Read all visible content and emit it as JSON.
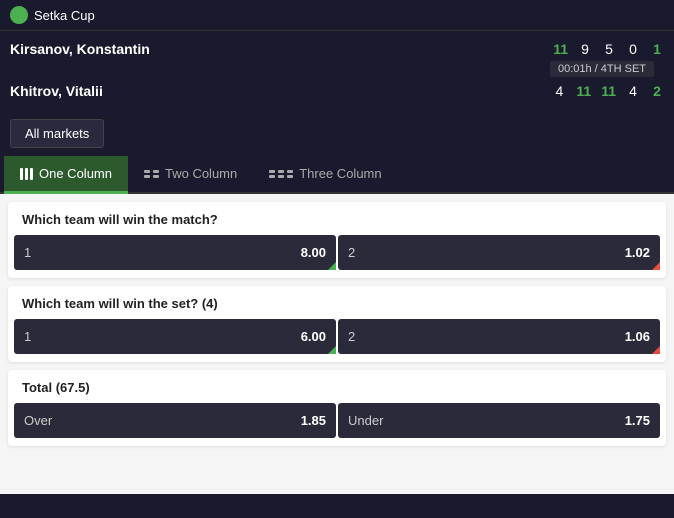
{
  "header": {
    "icon_color": "#4caf50",
    "title": "Setka Cup"
  },
  "match": {
    "player1": {
      "name": "Kirsanov, Konstantin",
      "scores": [
        "11",
        "9",
        "5",
        "0"
      ],
      "current_set_score": "1"
    },
    "player2": {
      "name": "Khitrov, Vitalii",
      "scores": [
        "4",
        "11",
        "11",
        "4"
      ],
      "current_set_score": "2"
    },
    "timer": "00:01h / 4TH SET"
  },
  "markets_button": {
    "label": "All markets"
  },
  "tabs": [
    {
      "id": "one-column",
      "label": "One Column",
      "icon": "one-col",
      "active": true
    },
    {
      "id": "two-column",
      "label": "Two Column",
      "icon": "two-col",
      "active": false
    },
    {
      "id": "three-column",
      "label": "Three Column",
      "icon": "three-col",
      "active": false
    }
  ],
  "markets": [
    {
      "id": "match-winner",
      "title": "Which team will win the match?",
      "odds": [
        {
          "label": "1",
          "value": "8.00",
          "indicator": "green"
        },
        {
          "label": "2",
          "value": "1.02",
          "indicator": "red"
        }
      ]
    },
    {
      "id": "set-winner",
      "title": "Which team will win the set? (4)",
      "odds": [
        {
          "label": "1",
          "value": "6.00",
          "indicator": "green"
        },
        {
          "label": "2",
          "value": "1.06",
          "indicator": "red"
        }
      ]
    },
    {
      "id": "total",
      "title": "Total (67.5)",
      "odds": [
        {
          "label": "Over",
          "value": "1.85",
          "indicator": "none"
        },
        {
          "label": "Under",
          "value": "1.75",
          "indicator": "none"
        }
      ]
    }
  ]
}
